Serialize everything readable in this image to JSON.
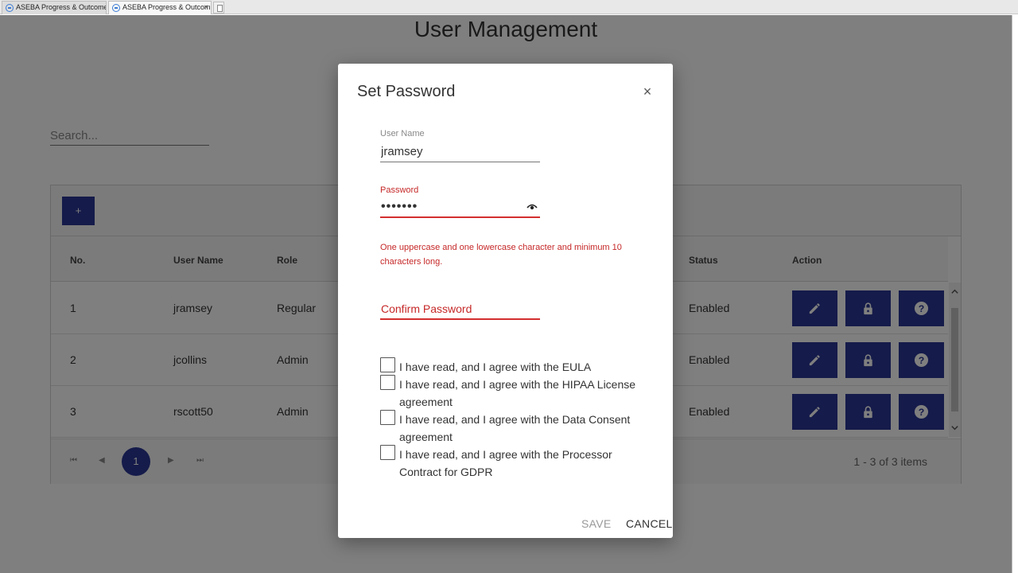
{
  "browser": {
    "tabs": [
      {
        "title": "ASEBA Progress & Outcomes ..."
      },
      {
        "title": "ASEBA Progress & Outcom..."
      }
    ]
  },
  "page": {
    "title": "User Management",
    "search_placeholder": "Search...",
    "add_button_label": "+",
    "columns": [
      "No.",
      "User Name",
      "Role",
      "Status",
      "Action"
    ],
    "rows": [
      {
        "no": "1",
        "username": "jramsey",
        "role": "Regular",
        "status": "Enabled"
      },
      {
        "no": "2",
        "username": "jcollins",
        "role": "Admin",
        "status": "Enabled"
      },
      {
        "no": "3",
        "username": "rscott50",
        "role": "Admin",
        "status": "Enabled"
      }
    ],
    "pager": {
      "current_page": "1",
      "info": "1 - 3 of 3 items"
    }
  },
  "dialog": {
    "title": "Set Password",
    "close_label": "×",
    "username_label": "User Name",
    "username_value": "jramsey",
    "password_label": "Password",
    "password_value": "•••••••",
    "password_error": "One uppercase and one lowercase character and minimum 10 characters long.",
    "confirm_password_placeholder": "Confirm Password",
    "agreements": [
      "I have read, and I agree with the EULA",
      "I have read, and I agree with the HIPAA License agreement",
      "I have read, and I agree with the Data Consent agreement",
      "I have read, and I agree with the Processor Contract for GDPR"
    ],
    "save_label": "SAVE",
    "cancel_label": "CANCEL"
  },
  "colors": {
    "accent": "#2a3795",
    "error": "#d32f2f"
  }
}
